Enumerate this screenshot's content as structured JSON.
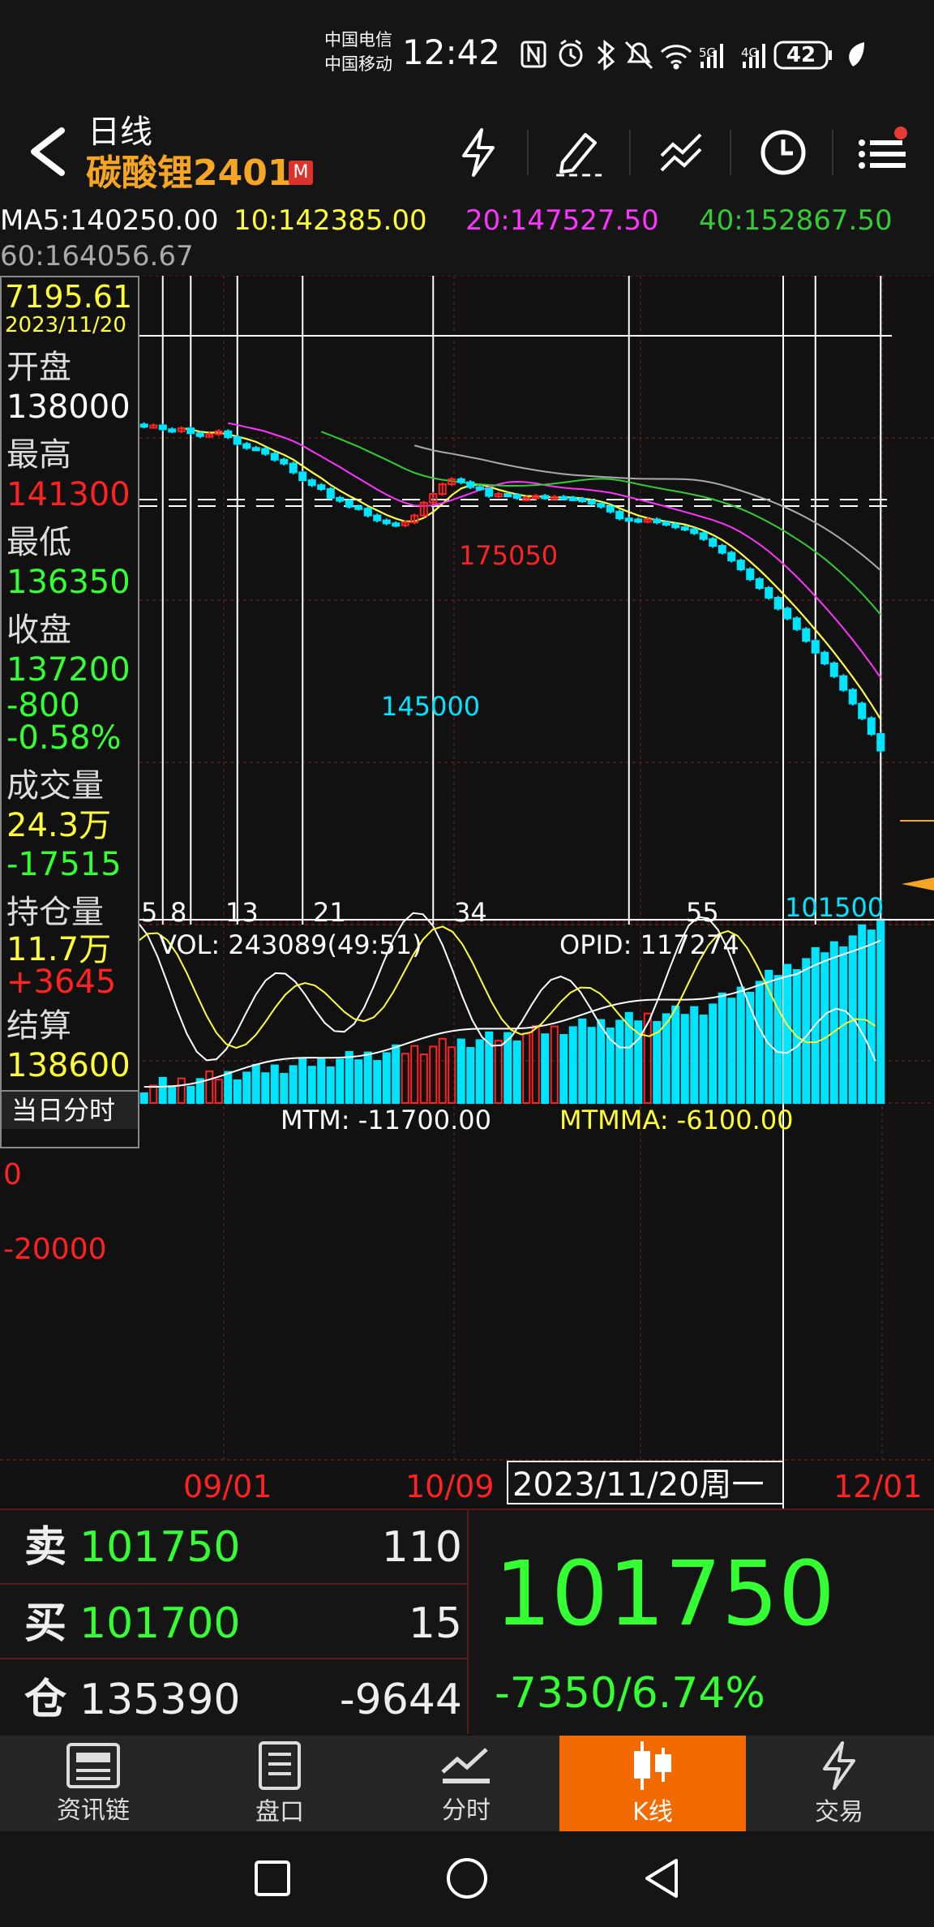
{
  "status": {
    "carrier1": "中国电信",
    "carrier2": "中国移动",
    "time": "12:42",
    "net5g": "5G",
    "net4g": "4G",
    "battery": "42"
  },
  "header": {
    "period": "日线",
    "symbol": "碳酸锂2401",
    "badge": "M"
  },
  "ma": {
    "ma5": "MA5:140250.00",
    "ma10": "10:142385.00",
    "ma20": "20:147527.50",
    "ma40": "40:152867.50",
    "ma60": "60:164056.67",
    "colors": {
      "ma5": "#ffffff",
      "ma10": "#ffff33",
      "ma20": "#ff33ff",
      "ma40": "#33cc33",
      "ma60": "#aaaaaa"
    }
  },
  "info": {
    "cursor_value": "7195.61",
    "cursor_date": "2023/11/20",
    "open_label": "开盘",
    "open": "138000",
    "high_label": "最高",
    "high": "141300",
    "low_label": "最低",
    "low": "136350",
    "close_label": "收盘",
    "close": "137200",
    "change": "-800",
    "change_pct": "-0.58%",
    "volume_label": "成交量",
    "volume": "24.3万",
    "volume_change": "-17515",
    "oi_label": "持仓量",
    "oi": "11.7万",
    "oi_change": "+3645",
    "settle_label": "结算",
    "settle": "138600",
    "intraday_button": "当日分时"
  },
  "chart": {
    "bar_counts": [
      "5",
      "8",
      "13",
      "21",
      "34",
      "55"
    ],
    "high_label": "175050",
    "low_label1": "145000",
    "low_label2": "101500",
    "vol_label": "VOL: 243089(49:51)",
    "opid_label": "OPID: 117274",
    "mtm_label": "MTM: -11700.00",
    "mtmma_label": "MTMMA: -6100.00",
    "mtm_zero": "0",
    "mtm_neg": "-20000",
    "dates": [
      "09/01",
      "10/09",
      "12/01"
    ],
    "cursor_date_label": "2023/11/20周一",
    "up_color": "#ff2222",
    "down_color": "#00e5ff"
  },
  "quote": {
    "sell_label": "卖",
    "sell_price": "101750",
    "sell_qty": "110",
    "buy_label": "买",
    "buy_price": "101700",
    "buy_qty": "15",
    "oi_label": "仓",
    "oi_value": "135390",
    "oi_delta": "-9644",
    "last_price": "101750",
    "change": "-7350/6.74%"
  },
  "nav": {
    "items": [
      "资讯链",
      "盘口",
      "分时",
      "K线",
      "交易"
    ],
    "active_color": "#f26a00"
  }
}
